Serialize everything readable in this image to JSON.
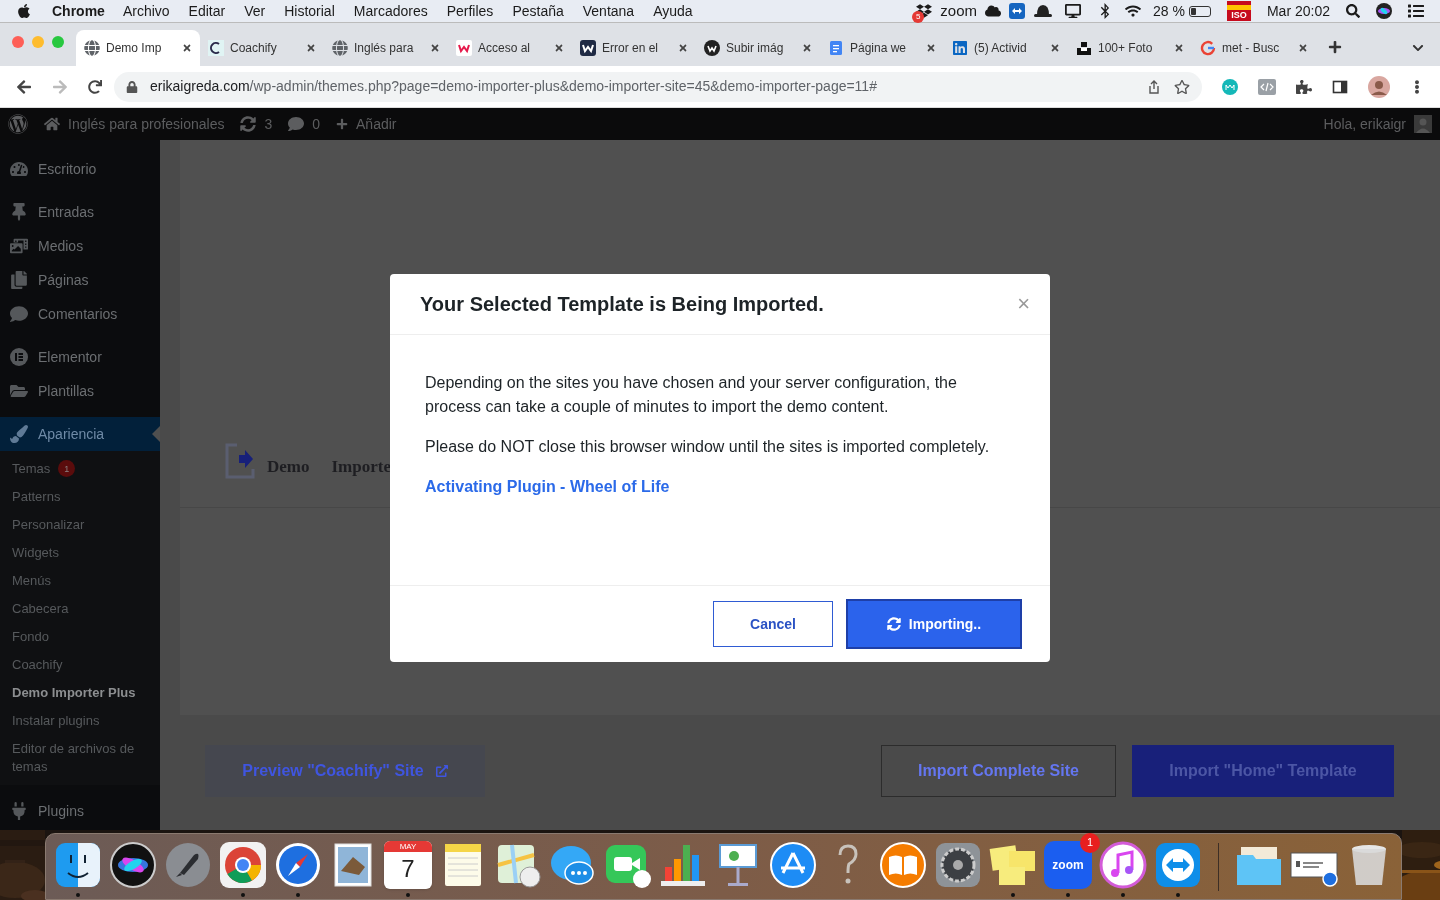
{
  "menubar": {
    "app": "Chrome",
    "menus": [
      "Archivo",
      "Editar",
      "Ver",
      "Historial",
      "Marcadores",
      "Perfiles",
      "Pestaña",
      "Ventana",
      "Ayuda"
    ],
    "dropbox_badge": "5",
    "zoom": "zoom",
    "battery": "28 %",
    "flag_label": "ISO",
    "clock": "Mar 20:02"
  },
  "tabs": [
    {
      "title": "Demo Imp",
      "selected": true
    },
    {
      "title": "Coachify",
      "selected": false
    },
    {
      "title": "Inglés para",
      "selected": false
    },
    {
      "title": "Acceso al",
      "selected": false
    },
    {
      "title": "Error en el",
      "selected": false
    },
    {
      "title": "Subir imág",
      "selected": false
    },
    {
      "title": "Página we",
      "selected": false
    },
    {
      "title": "(5) Activid",
      "selected": false
    },
    {
      "title": "100+ Foto",
      "selected": false
    },
    {
      "title": "met - Busc",
      "selected": false
    }
  ],
  "address": {
    "host": "erikaigreda.com",
    "path": "/wp-admin/themes.php?page=demo-importer-plus&demo-importer-site=45&demo-importer-page=11#"
  },
  "admin_bar": {
    "site": "Inglés para profesionales",
    "updates": "3",
    "comments": "0",
    "new": "Añadir",
    "greeting": "Hola, erikaigr"
  },
  "sidebar": {
    "groups": [
      [
        {
          "label": "Escritorio",
          "selected": false
        }
      ],
      [
        {
          "label": "Entradas",
          "selected": false
        },
        {
          "label": "Medios",
          "selected": false
        },
        {
          "label": "Páginas",
          "selected": false
        },
        {
          "label": "Comentarios",
          "selected": false
        }
      ],
      [
        {
          "label": "Elementor",
          "selected": false
        },
        {
          "label": "Plantillas",
          "selected": false
        }
      ],
      [
        {
          "label": "Apariencia",
          "selected": true,
          "children": [
            {
              "label": "Temas",
              "badge": "1",
              "selected": false
            },
            {
              "label": "Patterns",
              "selected": false
            },
            {
              "label": "Personalizar",
              "selected": false
            },
            {
              "label": "Widgets",
              "selected": false
            },
            {
              "label": "Menús",
              "selected": false
            },
            {
              "label": "Cabecera",
              "selected": false
            },
            {
              "label": "Fondo",
              "selected": false
            },
            {
              "label": "Coachify",
              "selected": false
            },
            {
              "label": "Demo Importer Plus",
              "selected": true
            },
            {
              "label": "Instalar plugins",
              "selected": false
            },
            {
              "label": "Editor de archivos de temas",
              "selected": false
            }
          ]
        }
      ],
      [
        {
          "label": "Plugins",
          "selected": false
        }
      ]
    ]
  },
  "page": {
    "heading": [
      "Demo",
      "Importe"
    ],
    "preview_button": "Preview \"Coachify\" Site",
    "complete_button": "Import Complete Site",
    "template_button": "Import \"Home\" Template"
  },
  "modal": {
    "title": "Your Selected Template is Being Imported.",
    "close": "×",
    "paragraphs": [
      "Depending on the sites you have chosen and your server configuration, the process can take a couple of minutes to import the demo content.",
      "Please do NOT close this browser window until the sites is imported completely."
    ],
    "status": "Activating Plugin - Wheel of Life",
    "cancel": "Cancel",
    "import": "Importing.."
  },
  "dock": [
    {
      "kind": "finder",
      "running": true
    },
    {
      "kind": "siri",
      "running": false
    },
    {
      "kind": "rocket",
      "running": false
    },
    {
      "kind": "chrome",
      "running": true
    },
    {
      "kind": "compass",
      "running": true
    },
    {
      "kind": "stamp",
      "running": false
    },
    {
      "kind": "calendar",
      "month": "MAY",
      "day": "7",
      "running": true
    },
    {
      "kind": "notes",
      "running": false
    },
    {
      "kind": "map",
      "running": false
    },
    {
      "kind": "bubble",
      "running": false
    },
    {
      "kind": "facetime",
      "running": false
    },
    {
      "kind": "chart",
      "running": false
    },
    {
      "kind": "keynote",
      "running": false
    },
    {
      "kind": "appstore",
      "running": false
    },
    {
      "kind": "question",
      "running": false
    },
    {
      "kind": "book",
      "running": false
    },
    {
      "kind": "gear",
      "running": false
    },
    {
      "kind": "stickies",
      "running": true
    },
    {
      "kind": "zoom",
      "label": "zoom",
      "badge": "1",
      "running": true
    },
    {
      "kind": "music",
      "running": true
    },
    {
      "kind": "arrows",
      "running": true
    },
    {
      "kind": "divider"
    },
    {
      "kind": "folder",
      "running": false
    },
    {
      "kind": "document",
      "running": false
    },
    {
      "kind": "trash",
      "running": false
    }
  ]
}
